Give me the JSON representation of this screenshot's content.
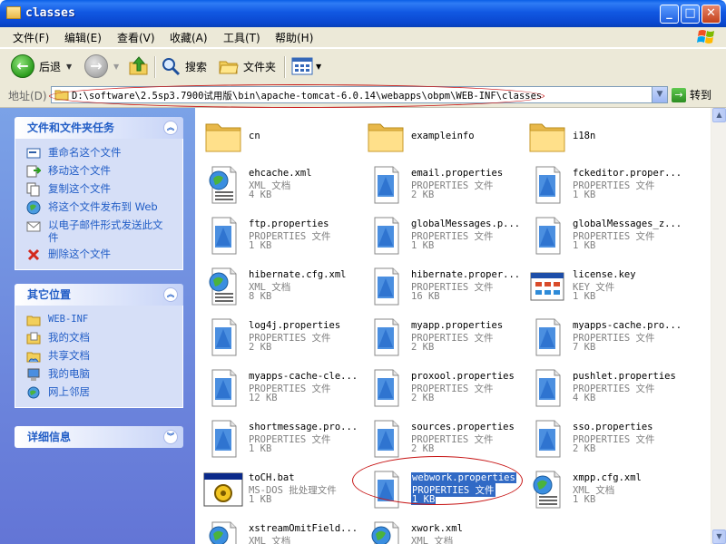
{
  "window": {
    "title": "classes",
    "min": "_",
    "max": "□",
    "close": "✕"
  },
  "menu": [
    "文件(F)",
    "编辑(E)",
    "查看(V)",
    "收藏(A)",
    "工具(T)",
    "帮助(H)"
  ],
  "toolbar": {
    "back": "后退",
    "search": "搜索",
    "folders": "文件夹"
  },
  "address": {
    "label": "地址(D)",
    "value": "D:\\software\\2.5sp3.7900试用版\\bin\\apache-tomcat-6.0.14\\webapps\\obpm\\WEB-INF\\classes",
    "go": "转到"
  },
  "panels": {
    "tasks": {
      "title": "文件和文件夹任务",
      "items": [
        {
          "label": "重命名这个文件",
          "icon": "rename-icon"
        },
        {
          "label": "移动这个文件",
          "icon": "move-icon"
        },
        {
          "label": "复制这个文件",
          "icon": "copy-icon"
        },
        {
          "label": "将这个文件发布到 Web",
          "icon": "publish-web-icon"
        },
        {
          "label": "以电子邮件形式发送此文件",
          "icon": "email-icon"
        },
        {
          "label": "删除这个文件",
          "icon": "delete-icon"
        }
      ]
    },
    "other": {
      "title": "其它位置",
      "items": [
        {
          "label": "WEB-INF",
          "icon": "folder-icon"
        },
        {
          "label": "我的文档",
          "icon": "my-documents-icon"
        },
        {
          "label": "共享文档",
          "icon": "shared-documents-icon"
        },
        {
          "label": "我的电脑",
          "icon": "my-computer-icon"
        },
        {
          "label": "网上邻居",
          "icon": "network-places-icon"
        }
      ]
    },
    "details": {
      "title": "详细信息"
    }
  },
  "files": [
    {
      "name": "cn",
      "type": "",
      "size": "",
      "kind": "folder"
    },
    {
      "name": "exampleinfo",
      "type": "",
      "size": "",
      "kind": "folder"
    },
    {
      "name": "i18n",
      "type": "",
      "size": "",
      "kind": "folder"
    },
    {
      "name": "ehcache.xml",
      "type": "XML 文档",
      "size": "4 KB",
      "kind": "xml"
    },
    {
      "name": "email.properties",
      "type": "PROPERTIES 文件",
      "size": "2 KB",
      "kind": "prop"
    },
    {
      "name": "fckeditor.proper...",
      "type": "PROPERTIES 文件",
      "size": "1 KB",
      "kind": "prop"
    },
    {
      "name": "ftp.properties",
      "type": "PROPERTIES 文件",
      "size": "1 KB",
      "kind": "prop"
    },
    {
      "name": "globalMessages.p...",
      "type": "PROPERTIES 文件",
      "size": "1 KB",
      "kind": "prop"
    },
    {
      "name": "globalMessages_z...",
      "type": "PROPERTIES 文件",
      "size": "1 KB",
      "kind": "prop"
    },
    {
      "name": "hibernate.cfg.xml",
      "type": "XML 文档",
      "size": "8 KB",
      "kind": "xml"
    },
    {
      "name": "hibernate.proper...",
      "type": "PROPERTIES 文件",
      "size": "16 KB",
      "kind": "prop"
    },
    {
      "name": "license.key",
      "type": "KEY 文件",
      "size": "1 KB",
      "kind": "key"
    },
    {
      "name": "log4j.properties",
      "type": "PROPERTIES 文件",
      "size": "2 KB",
      "kind": "prop"
    },
    {
      "name": "myapp.properties",
      "type": "PROPERTIES 文件",
      "size": "2 KB",
      "kind": "prop"
    },
    {
      "name": "myapps-cache.pro...",
      "type": "PROPERTIES 文件",
      "size": "7 KB",
      "kind": "prop"
    },
    {
      "name": "myapps-cache-cle...",
      "type": "PROPERTIES 文件",
      "size": "12 KB",
      "kind": "prop"
    },
    {
      "name": "proxool.properties",
      "type": "PROPERTIES 文件",
      "size": "2 KB",
      "kind": "prop"
    },
    {
      "name": "pushlet.properties",
      "type": "PROPERTIES 文件",
      "size": "4 KB",
      "kind": "prop"
    },
    {
      "name": "shortmessage.pro...",
      "type": "PROPERTIES 文件",
      "size": "1 KB",
      "kind": "prop"
    },
    {
      "name": "sources.properties",
      "type": "PROPERTIES 文件",
      "size": "2 KB",
      "kind": "prop"
    },
    {
      "name": "sso.properties",
      "type": "PROPERTIES 文件",
      "size": "2 KB",
      "kind": "prop"
    },
    {
      "name": "toCH.bat",
      "type": "MS-DOS 批处理文件",
      "size": "1 KB",
      "kind": "bat"
    },
    {
      "name": "webwork.properties",
      "type": "PROPERTIES 文件",
      "size": "1 KB",
      "kind": "prop",
      "selected": true
    },
    {
      "name": "xmpp.cfg.xml",
      "type": "XML 文档",
      "size": "1 KB",
      "kind": "xml"
    },
    {
      "name": "xstreamOmitField...",
      "type": "XML 文档",
      "size": "",
      "kind": "xml"
    },
    {
      "name": "xwork.xml",
      "type": "XML 文档",
      "size": "",
      "kind": "xml"
    }
  ]
}
